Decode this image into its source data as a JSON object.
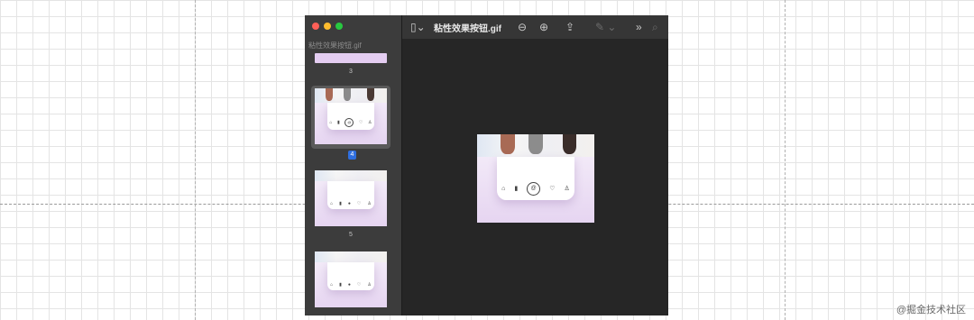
{
  "window": {
    "title": "粘性效果按钮.gif",
    "toolbar_icons": [
      "sidebar-toggle-icon",
      "zoom-out-icon",
      "zoom-in-icon",
      "share-icon",
      "markup-icon",
      "chevron-more-icon",
      "search-icon"
    ]
  },
  "sidebar": {
    "file_label": "粘性效果按钮.gif",
    "pages": [
      {
        "number": "3"
      },
      {
        "number": "4",
        "selected": true
      },
      {
        "number": "5"
      }
    ]
  },
  "watermark": "@掘金技术社区"
}
